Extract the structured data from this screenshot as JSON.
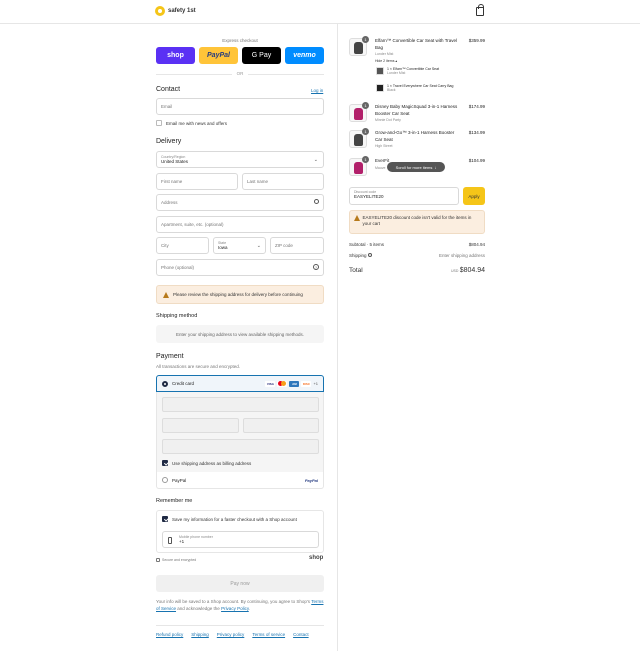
{
  "brand": {
    "name": "safety 1st"
  },
  "express": {
    "label": "Express checkout",
    "buttons": [
      "shop",
      "PayPal",
      "G Pay",
      "venmo"
    ],
    "or": "OR"
  },
  "contact": {
    "title": "Contact",
    "login": "Log in",
    "email_placeholder": "Email",
    "news_label": "Email me with news and offers"
  },
  "delivery": {
    "title": "Delivery",
    "country_label": "Country/Region",
    "country": "United States",
    "first_name": "First name",
    "last_name": "Last name",
    "address": "Address",
    "apartment": "Apartment, suite, etc. (optional)",
    "city": "City",
    "state_label": "State",
    "state": "Iowa",
    "zip": "ZIP code",
    "phone": "Phone (optional)",
    "notice": "Please review the shipping address for delivery before continuing"
  },
  "shipping": {
    "title": "Shipping method",
    "placeholder": "Enter your shipping address to view available shipping methods."
  },
  "payment": {
    "title": "Payment",
    "subtitle": "All transactions are secure and encrypted.",
    "credit_card": "Credit card",
    "more_brands": "+1",
    "billing_label": "Use shipping address as billing address",
    "paypal": "PayPal",
    "paypal_logo": "PayPal"
  },
  "remember": {
    "title": "Remember me",
    "save_label": "Save my information for a faster checkout with a Shop account",
    "phone_label": "Mobile phone number",
    "phone_prefix": "+1",
    "secure": "Secure and encrypted",
    "shop": "shop"
  },
  "pay_now": "Pay now",
  "terms": {
    "text1": "Your info will be saved to a Shop account. By continuing, you agree to Shop's ",
    "tos": "Terms of Service",
    "text2": " and acknowledge the ",
    "privacy": "Privacy Policy",
    "text3": "."
  },
  "footer": [
    "Refund policy",
    "Shipping",
    "Privacy policy",
    "Terms of service",
    "Contact"
  ],
  "cart": {
    "items": [
      {
        "name": "Elfarn™ Convertible Car Seat with Travel Bag",
        "variant": "Lunder Mist",
        "price": "$359.99",
        "qty": "1",
        "hide": "Hide 2 items ▴"
      },
      {
        "name": "Disney Baby MagicSquad 3-in-1 Harness Booster Car Seat",
        "variant": "Minnie Dot Party",
        "price": "$174.99",
        "qty": "1"
      },
      {
        "name": "Grow-and-Go™ 3-in-1 Harness Booster Car Seat",
        "variant": "High Street",
        "price": "$134.99",
        "qty": "1"
      },
      {
        "name": "EverFit",
        "variant": "Mauve",
        "price": "$104.99",
        "qty": "1"
      }
    ],
    "bundle": [
      {
        "name": "1 × Elfarn™ Convertible Car Seat",
        "variant": "Lunder Mist"
      },
      {
        "name": "1 × Travel Everywhere Car Seat Carry Bag",
        "variant": "Black"
      }
    ],
    "scroll_toast": "Scroll for more items",
    "discount_label": "Discount code",
    "discount_value": "EASYELITE20",
    "apply": "Apply",
    "discount_error": "EASYELITE20 discount code isn't valid for the items in your cart",
    "subtotal_label": "Subtotal · 5 items",
    "subtotal": "$804.94",
    "shipping_label": "Shipping",
    "shipping_value": "Enter shipping address",
    "total_label": "Total",
    "currency": "USD",
    "total": "$804.94"
  }
}
